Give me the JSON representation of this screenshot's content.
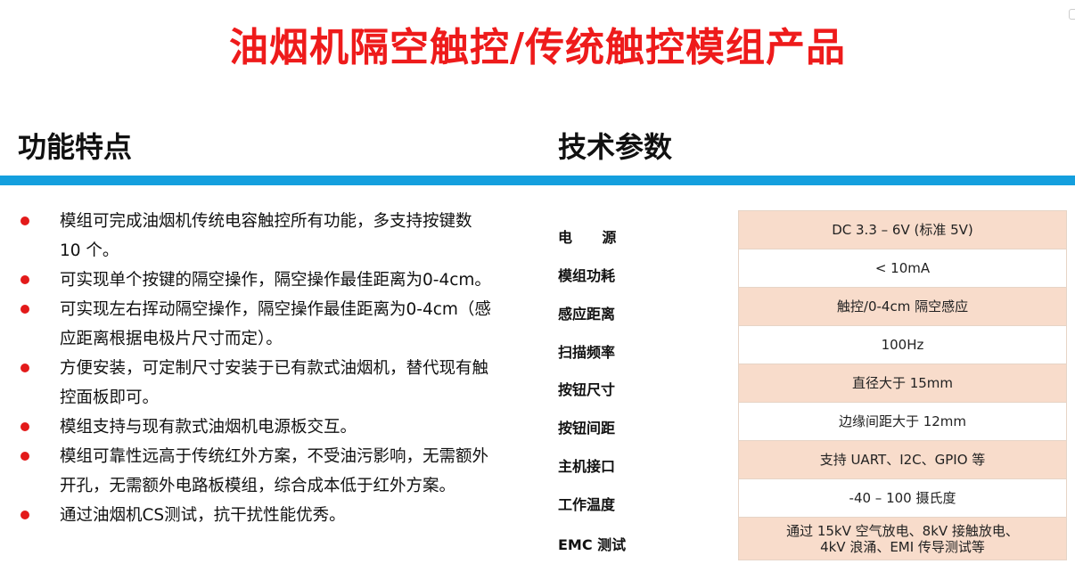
{
  "title": "油烟机隔空触控/传统触控模组产品",
  "features_heading": "功能特点",
  "specs_heading": "技术参数",
  "accent_colors": {
    "title_red": "#ee1b1b",
    "divider_blue": "#149fde",
    "bullet_red": "#e31a1a",
    "table_shade": "#f8dccb"
  },
  "features": [
    {
      "line1": "模组可完成油烟机传统电容触控所有功能，多支持按键数",
      "line2": "10 个。"
    },
    {
      "line1": "可实现单个按键的隔空操作，隔空操作最佳距离为0-4cm。",
      "line2": ""
    },
    {
      "line1": "可实现左右挥动隔空操作，隔空操作最佳距离为0-4cm（感",
      "line2": "应距离根据电极片尺寸而定）。"
    },
    {
      "line1": "方便安装，可定制尺寸安装于已有款式油烟机，替代现有触",
      "line2": "控面板即可。"
    },
    {
      "line1": "模组支持与现有款式油烟机电源板交互。",
      "line2": ""
    },
    {
      "line1": "模组可靠性远高于传统红外方案，不受油污影响，无需额外",
      "line2": "开孔，无需额外电路板模组，综合成本低于红外方案。"
    },
    {
      "line1": "通过油烟机CS测试，抗干扰性能优秀。",
      "line2": ""
    }
  ],
  "specs": [
    {
      "label": "电      源",
      "value": "DC 3.3 – 6V (标准 5V)",
      "value2": ""
    },
    {
      "label": "模组功耗",
      "value": "< 10mA",
      "value2": ""
    },
    {
      "label": "感应距离",
      "value": "触控/0-4cm 隔空感应",
      "value2": ""
    },
    {
      "label": "扫描频率",
      "value": "100Hz",
      "value2": ""
    },
    {
      "label": "按钮尺寸",
      "value": "直径大于 15mm",
      "value2": ""
    },
    {
      "label": "按钮间距",
      "value": "边缘间距大于 12mm",
      "value2": ""
    },
    {
      "label": "主机接口",
      "value": "支持 UART、I2C、GPIO 等",
      "value2": ""
    },
    {
      "label": "工作温度",
      "value": "-40 – 100 摄氏度",
      "value2": ""
    },
    {
      "label": "EMC 测试",
      "value": "通过 15kV 空气放电、8kV 接触放电、",
      "value2": "4kV 浪涌、EMI 传导测试等"
    }
  ]
}
